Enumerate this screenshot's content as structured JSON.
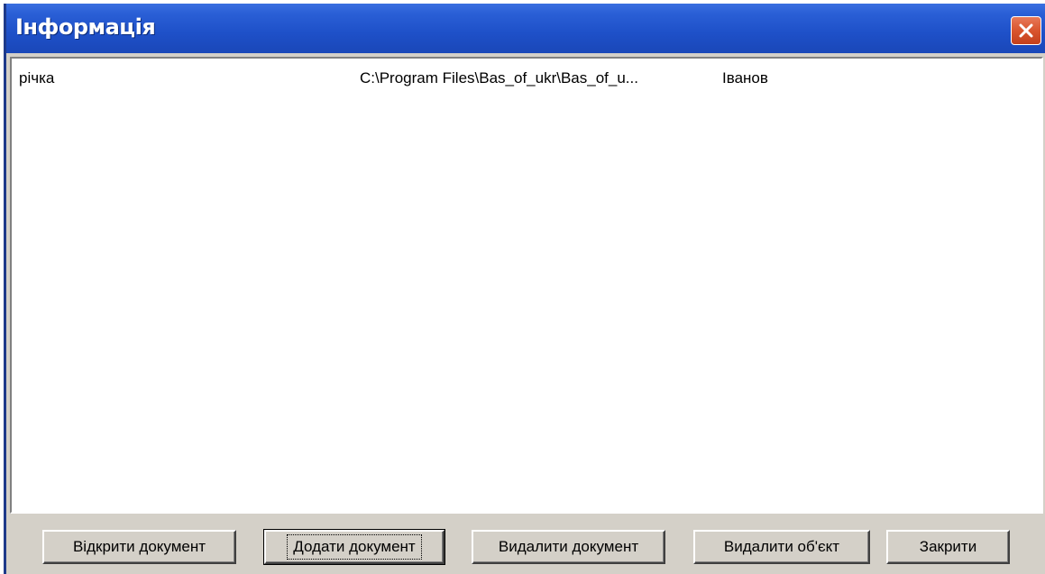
{
  "window": {
    "title": "Інформація"
  },
  "list": {
    "rows": [
      {
        "name": "річка",
        "path": "C:\\Program Files\\Bas_of_ukr\\Bas_of_u...",
        "author": "Іванов"
      }
    ]
  },
  "buttons": {
    "open_document": "Відкрити документ",
    "add_document": "Додати документ",
    "delete_document": "Видалити документ",
    "delete_object": "Видалити об'єкт",
    "close": "Закрити"
  },
  "icons": {
    "close": "close-icon"
  },
  "colors": {
    "titlebar": "#1e50c8",
    "close_button": "#d9552e",
    "face": "#d4d0c8"
  }
}
